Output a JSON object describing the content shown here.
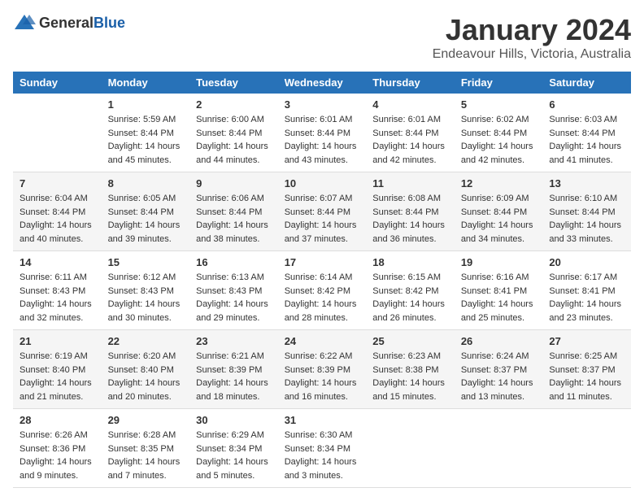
{
  "header": {
    "logo_general": "General",
    "logo_blue": "Blue",
    "month": "January 2024",
    "location": "Endeavour Hills, Victoria, Australia"
  },
  "weekdays": [
    "Sunday",
    "Monday",
    "Tuesday",
    "Wednesday",
    "Thursday",
    "Friday",
    "Saturday"
  ],
  "weeks": [
    [
      {
        "day": "",
        "info": ""
      },
      {
        "day": "1",
        "info": "Sunrise: 5:59 AM\nSunset: 8:44 PM\nDaylight: 14 hours\nand 45 minutes."
      },
      {
        "day": "2",
        "info": "Sunrise: 6:00 AM\nSunset: 8:44 PM\nDaylight: 14 hours\nand 44 minutes."
      },
      {
        "day": "3",
        "info": "Sunrise: 6:01 AM\nSunset: 8:44 PM\nDaylight: 14 hours\nand 43 minutes."
      },
      {
        "day": "4",
        "info": "Sunrise: 6:01 AM\nSunset: 8:44 PM\nDaylight: 14 hours\nand 42 minutes."
      },
      {
        "day": "5",
        "info": "Sunrise: 6:02 AM\nSunset: 8:44 PM\nDaylight: 14 hours\nand 42 minutes."
      },
      {
        "day": "6",
        "info": "Sunrise: 6:03 AM\nSunset: 8:44 PM\nDaylight: 14 hours\nand 41 minutes."
      }
    ],
    [
      {
        "day": "7",
        "info": "Sunrise: 6:04 AM\nSunset: 8:44 PM\nDaylight: 14 hours\nand 40 minutes."
      },
      {
        "day": "8",
        "info": "Sunrise: 6:05 AM\nSunset: 8:44 PM\nDaylight: 14 hours\nand 39 minutes."
      },
      {
        "day": "9",
        "info": "Sunrise: 6:06 AM\nSunset: 8:44 PM\nDaylight: 14 hours\nand 38 minutes."
      },
      {
        "day": "10",
        "info": "Sunrise: 6:07 AM\nSunset: 8:44 PM\nDaylight: 14 hours\nand 37 minutes."
      },
      {
        "day": "11",
        "info": "Sunrise: 6:08 AM\nSunset: 8:44 PM\nDaylight: 14 hours\nand 36 minutes."
      },
      {
        "day": "12",
        "info": "Sunrise: 6:09 AM\nSunset: 8:44 PM\nDaylight: 14 hours\nand 34 minutes."
      },
      {
        "day": "13",
        "info": "Sunrise: 6:10 AM\nSunset: 8:44 PM\nDaylight: 14 hours\nand 33 minutes."
      }
    ],
    [
      {
        "day": "14",
        "info": "Sunrise: 6:11 AM\nSunset: 8:43 PM\nDaylight: 14 hours\nand 32 minutes."
      },
      {
        "day": "15",
        "info": "Sunrise: 6:12 AM\nSunset: 8:43 PM\nDaylight: 14 hours\nand 30 minutes."
      },
      {
        "day": "16",
        "info": "Sunrise: 6:13 AM\nSunset: 8:43 PM\nDaylight: 14 hours\nand 29 minutes."
      },
      {
        "day": "17",
        "info": "Sunrise: 6:14 AM\nSunset: 8:42 PM\nDaylight: 14 hours\nand 28 minutes."
      },
      {
        "day": "18",
        "info": "Sunrise: 6:15 AM\nSunset: 8:42 PM\nDaylight: 14 hours\nand 26 minutes."
      },
      {
        "day": "19",
        "info": "Sunrise: 6:16 AM\nSunset: 8:41 PM\nDaylight: 14 hours\nand 25 minutes."
      },
      {
        "day": "20",
        "info": "Sunrise: 6:17 AM\nSunset: 8:41 PM\nDaylight: 14 hours\nand 23 minutes."
      }
    ],
    [
      {
        "day": "21",
        "info": "Sunrise: 6:19 AM\nSunset: 8:40 PM\nDaylight: 14 hours\nand 21 minutes."
      },
      {
        "day": "22",
        "info": "Sunrise: 6:20 AM\nSunset: 8:40 PM\nDaylight: 14 hours\nand 20 minutes."
      },
      {
        "day": "23",
        "info": "Sunrise: 6:21 AM\nSunset: 8:39 PM\nDaylight: 14 hours\nand 18 minutes."
      },
      {
        "day": "24",
        "info": "Sunrise: 6:22 AM\nSunset: 8:39 PM\nDaylight: 14 hours\nand 16 minutes."
      },
      {
        "day": "25",
        "info": "Sunrise: 6:23 AM\nSunset: 8:38 PM\nDaylight: 14 hours\nand 15 minutes."
      },
      {
        "day": "26",
        "info": "Sunrise: 6:24 AM\nSunset: 8:37 PM\nDaylight: 14 hours\nand 13 minutes."
      },
      {
        "day": "27",
        "info": "Sunrise: 6:25 AM\nSunset: 8:37 PM\nDaylight: 14 hours\nand 11 minutes."
      }
    ],
    [
      {
        "day": "28",
        "info": "Sunrise: 6:26 AM\nSunset: 8:36 PM\nDaylight: 14 hours\nand 9 minutes."
      },
      {
        "day": "29",
        "info": "Sunrise: 6:28 AM\nSunset: 8:35 PM\nDaylight: 14 hours\nand 7 minutes."
      },
      {
        "day": "30",
        "info": "Sunrise: 6:29 AM\nSunset: 8:34 PM\nDaylight: 14 hours\nand 5 minutes."
      },
      {
        "day": "31",
        "info": "Sunrise: 6:30 AM\nSunset: 8:34 PM\nDaylight: 14 hours\nand 3 minutes."
      },
      {
        "day": "",
        "info": ""
      },
      {
        "day": "",
        "info": ""
      },
      {
        "day": "",
        "info": ""
      }
    ]
  ]
}
